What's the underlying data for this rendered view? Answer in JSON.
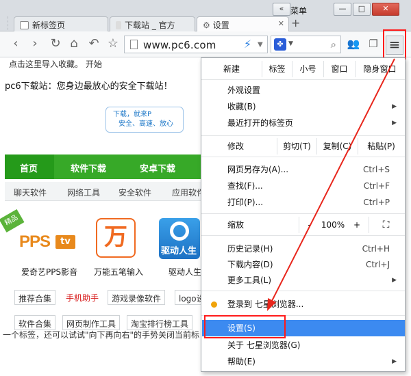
{
  "window": {
    "menu_label": "菜单",
    "btn_dropdown": "«",
    "btn_minimize": "—",
    "btn_restore": "□",
    "btn_close": "✕"
  },
  "tabs": [
    {
      "label": "新标签页"
    },
    {
      "label": "下载站 _ 官方"
    },
    {
      "label": "设置"
    }
  ],
  "toolbar": {
    "url": "www.pc6.com",
    "back_icon": "‹",
    "forward_icon": "›",
    "reload_icon": "↻",
    "home_icon": "⌂",
    "undo_icon": "↶",
    "star_icon": "☆",
    "search_engine_icon": "paw-icon",
    "menu_icon": "≡"
  },
  "bookmarks": {
    "import_text": "点击这里导入收藏。",
    "start_text": "开始"
  },
  "page": {
    "banner": "pc6下载站：您身边最放心的安全下载站！",
    "bubble_line1": "下载，就来P",
    "bubble_line2": "安全、高速、放心",
    "nav": [
      "首页",
      "软件下载",
      "安卓下载"
    ],
    "subnav": [
      "聊天软件",
      "网络工具",
      "安全软件",
      "应用软件"
    ],
    "ribbon": "精品",
    "pps_logo": "PPS",
    "pps_tv": "tv",
    "wan_glyph": "万",
    "drv_text": "驱动人生",
    "apps": [
      "爱奇艺PPS影音",
      "万能五笔输入",
      "驱动人生"
    ],
    "chips_row1": [
      "推荐合集",
      "手机助手",
      "游戏录像软件",
      "logo设"
    ],
    "chips_row2": [
      "软件合集",
      "网页制作工具",
      "淘宝排行榜工具"
    ],
    "caption": "一个标签，还可以试试\"向下再向右\"的手势关闭当前标"
  },
  "menu": {
    "top_row": [
      "新建",
      "标签",
      "小号",
      "窗口",
      "隐身窗口"
    ],
    "appearance": "外观设置",
    "favorites": "收藏(B)",
    "recent_tabs": "最近打开的标签页",
    "edit_label": "修改",
    "cut": "剪切(T)",
    "copy": "复制(C)",
    "paste": "粘贴(P)",
    "save_as": "网页另存为(A)...",
    "save_as_sc": "Ctrl+S",
    "find": "查找(F)...",
    "find_sc": "Ctrl+F",
    "print": "打印(P)...",
    "print_sc": "Ctrl+P",
    "zoom_label": "缩放",
    "zoom_minus": "-",
    "zoom_value": "100%",
    "zoom_plus": "+",
    "fullscreen_icon": "⛶",
    "history": "历史记录(H)",
    "history_sc": "Ctrl+H",
    "downloads": "下载内容(D)",
    "downloads_sc": "Ctrl+J",
    "more_tools": "更多工具(L)",
    "login": "登录到 七星浏览器...",
    "settings": "设置(S)",
    "about": "关于 七星浏览器(G)",
    "help": "帮助(E)",
    "submenu_arrow": "▶"
  },
  "colors": {
    "annotation": "#ff1a1a",
    "menu_highlight": "#3c8af0",
    "nav_green": "#37a928",
    "login_dot": "#f0a30a"
  }
}
